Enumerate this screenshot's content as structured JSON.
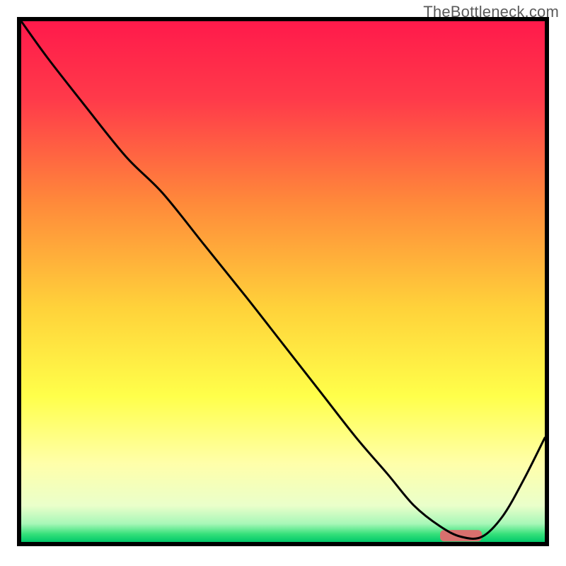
{
  "watermark": "TheBottleneck.com",
  "chart_data": {
    "type": "line",
    "title": "",
    "xlabel": "",
    "ylabel": "",
    "xlim": [
      0,
      100
    ],
    "ylim": [
      0,
      100
    ],
    "background": {
      "type": "vertical-gradient",
      "stops": [
        {
          "offset": 0.0,
          "color": "#ff1a4b"
        },
        {
          "offset": 0.15,
          "color": "#ff3a4a"
        },
        {
          "offset": 0.35,
          "color": "#ff8a3a"
        },
        {
          "offset": 0.55,
          "color": "#ffd23a"
        },
        {
          "offset": 0.72,
          "color": "#ffff4a"
        },
        {
          "offset": 0.85,
          "color": "#ffffaa"
        },
        {
          "offset": 0.93,
          "color": "#eaffca"
        },
        {
          "offset": 0.965,
          "color": "#a8f7b8"
        },
        {
          "offset": 0.985,
          "color": "#35e07a"
        },
        {
          "offset": 1.0,
          "color": "#00c86a"
        }
      ]
    },
    "series": [
      {
        "name": "bottleneck-curve",
        "color": "#000000",
        "width": 3,
        "x": [
          0,
          5,
          12,
          20,
          27,
          35,
          43,
          50,
          57,
          64,
          70,
          75,
          80,
          84,
          88,
          92,
          96,
          100
        ],
        "y": [
          100,
          93,
          84,
          74,
          67,
          57,
          47,
          38,
          29,
          20,
          13,
          7,
          3,
          1,
          1,
          5,
          12,
          20
        ]
      }
    ],
    "marker": {
      "name": "optimal-range",
      "color": "#d9706e",
      "x_start": 80,
      "x_end": 88,
      "y": 1.2,
      "thickness": 2.2
    }
  }
}
